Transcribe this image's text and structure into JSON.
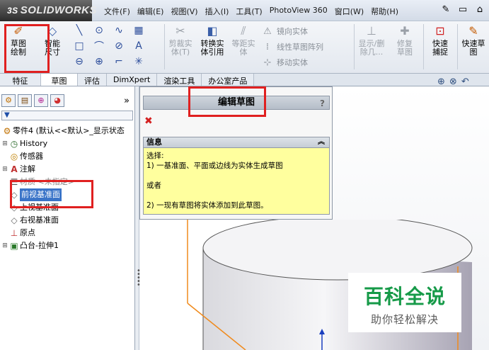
{
  "app": {
    "logo": "SOLIDWORKS"
  },
  "menu": {
    "items": [
      "文件(F)",
      "编辑(E)",
      "视图(V)",
      "插入(I)",
      "工具(T)",
      "PhotoView 360",
      "窗口(W)",
      "帮助(H)"
    ]
  },
  "ribbon": {
    "sketch_edit_label": "草图绘制",
    "smart_dim_label": "智能尺寸",
    "trim_label": "剪裁实体(T)",
    "convert_label": "转换实体引用",
    "offset_label": "等距实体",
    "mirror_label": "镜向实体",
    "linear_pattern_label": "线性草图阵列",
    "move_label": "移动实体",
    "show_delete_label": "显示/删除几...",
    "repair_label": "修复草图",
    "quick_snap_label": "快速捕捉",
    "quick_sketch_label": "快速草图"
  },
  "tabs": [
    "特征",
    "草图",
    "评估",
    "DimXpert",
    "渲染工具",
    "办公室产品"
  ],
  "active_tab": 1,
  "tree": {
    "root": "零件4 (默认<<默认>_显示状态",
    "nodes": [
      {
        "label": "History",
        "icon": "history-icon",
        "expandable": true
      },
      {
        "label": "传感器",
        "icon": "sensor-icon",
        "expandable": false
      },
      {
        "label": "注解",
        "icon": "annotation-icon",
        "expandable": true
      },
      {
        "label": "材质 <未指定>",
        "icon": "material-icon",
        "expandable": false
      },
      {
        "label": "前视基准面",
        "icon": "plane-icon",
        "expandable": false,
        "selected": true
      },
      {
        "label": "上视基准面",
        "icon": "plane-icon",
        "expandable": false
      },
      {
        "label": "右视基准面",
        "icon": "plane-icon",
        "expandable": false
      },
      {
        "label": "原点",
        "icon": "origin-icon",
        "expandable": false
      },
      {
        "label": "凸台-拉伸1",
        "icon": "extrude-icon",
        "expandable": true
      }
    ]
  },
  "property_manager": {
    "title": "编辑草图",
    "help": "?",
    "info_header": "信息",
    "info_lines": [
      "选择:",
      "1) 一基准面、平面或边线为实体生成草图",
      "",
      "或者",
      "",
      "2) 一现有草图将实体添加到此草图。"
    ]
  },
  "watermark": {
    "title": "百科全说",
    "subtitle": "助你轻松解决"
  },
  "colors": {
    "annotation_red": "#e02020",
    "selection_blue": "#3a74c8",
    "info_yellow": "#ffff9e",
    "edge_orange": "#f08a1c",
    "watermark_green": "#169a48"
  }
}
